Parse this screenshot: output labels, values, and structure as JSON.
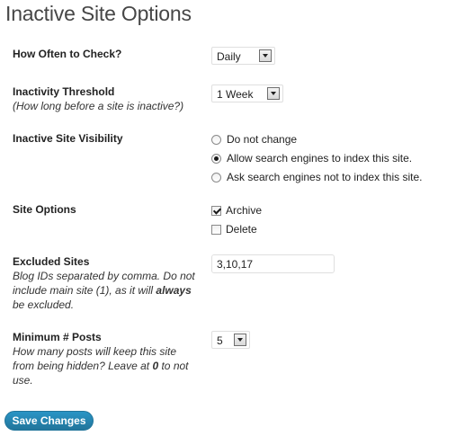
{
  "page": {
    "title": "Inactive Site Options"
  },
  "fields": {
    "check_frequency": {
      "label": "How Often to Check?",
      "selected": "Daily"
    },
    "inactivity_threshold": {
      "label": "Inactivity Threshold",
      "description": "(How long before a site is inactive?)",
      "selected": "1 Week"
    },
    "visibility": {
      "label": "Inactive Site Visibility",
      "options": [
        {
          "label": "Do not change",
          "checked": false
        },
        {
          "label": "Allow search engines to index this site.",
          "checked": true
        },
        {
          "label": "Ask search engines not to index this site.",
          "checked": false
        }
      ]
    },
    "site_options": {
      "label": "Site Options",
      "options": [
        {
          "label": "Archive",
          "checked": true
        },
        {
          "label": "Delete",
          "checked": false
        }
      ]
    },
    "excluded_sites": {
      "label": "Excluded Sites",
      "description_part1": "Blog IDs separated by comma. Do not include main site (1), as it will ",
      "description_bold": "always",
      "description_part2": " be excluded.",
      "value": "3,10,17"
    },
    "minimum_posts": {
      "label": "Minimum # Posts",
      "description_part1": "How many posts will keep this site from being hidden? Leave at ",
      "description_bold": "0",
      "description_part2": " to not use.",
      "selected": "5"
    }
  },
  "actions": {
    "save_label": "Save Changes"
  }
}
